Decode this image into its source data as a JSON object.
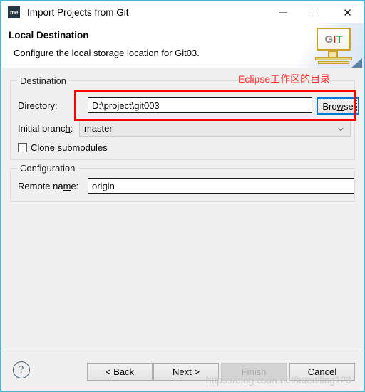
{
  "window": {
    "title": "Import Projects from Git",
    "app_icon_label": "me",
    "controls": {
      "minimize": "minimize-icon",
      "maximize": "maximize-icon",
      "close": "✕"
    },
    "border_color": "#4db5cc"
  },
  "header": {
    "title": "Local Destination",
    "description": "Configure the local storage location for Git03.",
    "logo": {
      "g": "G",
      "i": "I",
      "t": "T",
      "g_color": "#8c8c8c",
      "i_color": "#cc2222",
      "t_color": "#2e9e4a"
    }
  },
  "destination": {
    "legend": "Destination",
    "directory": {
      "label_pre": "D",
      "label_mid": "irectory:",
      "value": "D:\\project\\git003",
      "browse_label_pre": "Bro",
      "browse_label_mid": "w",
      "browse_label_post": "se"
    },
    "initial_branch": {
      "label_pre": "Initial branc",
      "label_mid": "h",
      "label_post": ":",
      "value": "master"
    },
    "clone_submodules": {
      "label_pre": "Clone ",
      "label_mid": "s",
      "label_post": "ubmodules",
      "checked": false
    }
  },
  "configuration": {
    "legend": "Configuration",
    "remote_name": {
      "label_pre": "Remote na",
      "label_mid": "m",
      "label_post": "e:",
      "value": "origin"
    }
  },
  "annotation": {
    "text": "Eclipse工作区的目录",
    "color": "#ff2d2d",
    "box_color": "#ff0000"
  },
  "footer": {
    "help_label": "?",
    "buttons": [
      {
        "name": "back",
        "pre": "< ",
        "mid": "B",
        "post": "ack",
        "disabled": false
      },
      {
        "name": "next",
        "pre": "",
        "mid": "N",
        "post": "ext >",
        "disabled": false
      },
      {
        "name": "finish",
        "pre": "",
        "mid": "F",
        "post": "inish",
        "disabled": true
      },
      {
        "name": "cancel",
        "pre": "",
        "mid": "C",
        "post": "ancel",
        "disabled": false
      }
    ],
    "watermark": "https://blog.csdn.net/xueailing123"
  }
}
